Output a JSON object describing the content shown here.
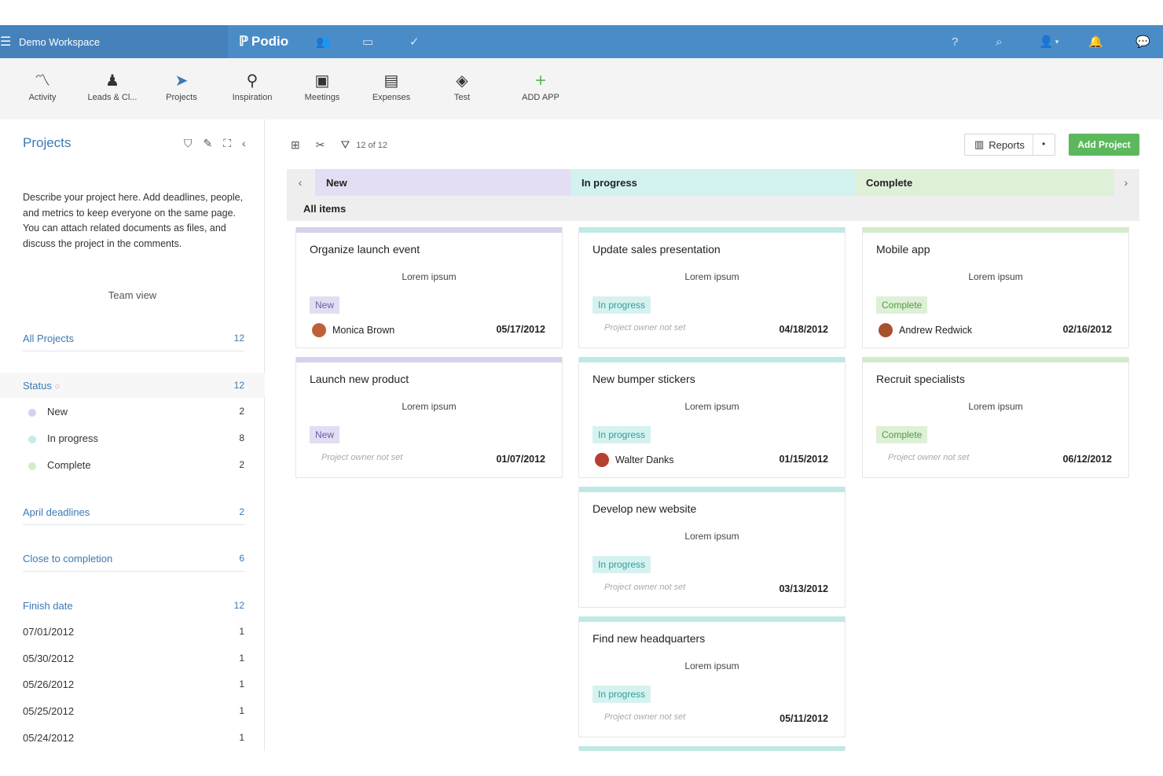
{
  "topbar": {
    "workspace": "Demo Workspace",
    "logo": "Podio",
    "icons": [
      "contacts-icon",
      "calendar-icon",
      "tasks-icon",
      "help-icon",
      "search-icon",
      "user-icon",
      "notifications-icon",
      "chat-icon"
    ],
    "help_label": "?",
    "user_caret": "▾"
  },
  "apps": [
    {
      "label": "Activity",
      "icon": "activity-icon"
    },
    {
      "label": "Leads & Cl...",
      "icon": "leads-icon"
    },
    {
      "label": "Projects",
      "icon": "projects-icon"
    },
    {
      "label": "Inspiration",
      "icon": "inspiration-icon"
    },
    {
      "label": "Meetings",
      "icon": "meetings-icon"
    },
    {
      "label": "Expenses",
      "icon": "expenses-icon"
    },
    {
      "label": "Test",
      "icon": "test-icon"
    },
    {
      "label": "ADD APP",
      "icon": "add-app-icon"
    }
  ],
  "sidebar": {
    "title": "Projects",
    "description": "Describe your project here. Add deadlines, people, and metrics to keep everyone on the same page. You can attach related documents as files, and discuss the project in the comments.",
    "team_view": "Team view",
    "all_projects": {
      "label": "All Projects",
      "count": "12"
    },
    "status": {
      "label": "Status",
      "count": "12"
    },
    "status_items": [
      {
        "label": "New",
        "count": "2",
        "color": "#d7d0ee"
      },
      {
        "label": "In progress",
        "count": "8",
        "color": "#c4ecea"
      },
      {
        "label": "Complete",
        "count": "2",
        "color": "#d3ebc9"
      }
    ],
    "april_deadlines": {
      "label": "April deadlines",
      "count": "2"
    },
    "close_to_completion": {
      "label": "Close to completion",
      "count": "6"
    },
    "finish_date": {
      "label": "Finish date",
      "count": "12"
    },
    "finish_dates": [
      {
        "label": "07/01/2012",
        "count": "1"
      },
      {
        "label": "05/30/2012",
        "count": "1"
      },
      {
        "label": "05/26/2012",
        "count": "1"
      },
      {
        "label": "05/25/2012",
        "count": "1"
      },
      {
        "label": "05/24/2012",
        "count": "1"
      }
    ]
  },
  "toolbar": {
    "count": "12 of 12",
    "reports_label": "Reports",
    "add_project_label": "Add Project"
  },
  "columns": [
    {
      "label": "New",
      "color": "#e4def4"
    },
    {
      "label": "In progress",
      "color": "#d2f2f0"
    },
    {
      "label": "Complete",
      "color": "#dff0d9"
    }
  ],
  "all_items_label": "All items",
  "status_labels": {
    "new": "New",
    "prog": "In progress",
    "comp": "Complete"
  },
  "cards": [
    {
      "title": "Organize launch event",
      "desc": "Lorem ipsum",
      "status": "New",
      "owner": "Monica Brown",
      "date": "05/17/2012"
    },
    {
      "title": "Launch new product",
      "desc": "Lorem ipsum",
      "status": "New",
      "owner": "Project owner not set",
      "date": "01/07/2012"
    },
    {
      "title": "Update sales presentation",
      "desc": "Lorem ipsum",
      "status": "In progress",
      "owner": "Project owner not set",
      "date": "04/18/2012"
    },
    {
      "title": "New bumper stickers",
      "desc": "Lorem ipsum",
      "status": "In progress",
      "owner": "Walter Danks",
      "date": "01/15/2012"
    },
    {
      "title": "Develop new website",
      "desc": "Lorem ipsum",
      "status": "In progress",
      "owner": "Project owner not set",
      "date": "03/13/2012"
    },
    {
      "title": "Find new headquarters",
      "desc": "Lorem ipsum",
      "status": "In progress",
      "owner": "Project owner not set",
      "date": "05/11/2012"
    },
    {
      "title": "Mobile app",
      "desc": "Lorem ipsum",
      "status": "Complete",
      "owner": "Andrew Redwick",
      "date": "02/16/2012"
    },
    {
      "title": "Recruit specialists",
      "desc": "Lorem ipsum",
      "status": "Complete",
      "owner": "Project owner not set",
      "date": "06/12/2012"
    }
  ],
  "colors": {
    "topbar": "#4a8cc7",
    "link": "#3c78b5",
    "add_button": "#5cb85c",
    "new_bar": "#d7d0ee",
    "progress_bar": "#bfe9e6",
    "complete_bar": "#d3ebc9"
  }
}
